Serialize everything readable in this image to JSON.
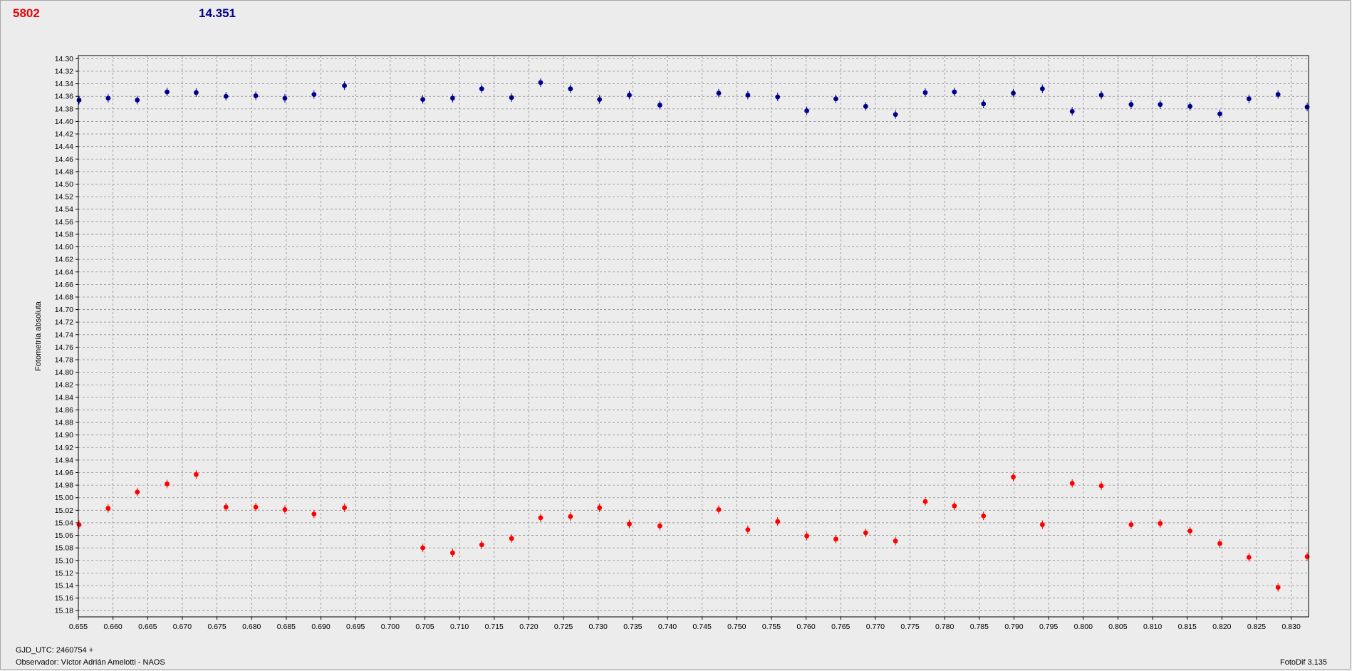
{
  "header": {
    "red_value": "5802",
    "blue_value": "14.351"
  },
  "footer": {
    "gjd": "GJD_UTC: 2460754 +",
    "observer": "Observador: Víctor Adrián Amelotti - NAOS",
    "version": "FotoDif 3.135"
  },
  "colors": {
    "background": "#ececec",
    "plot_bg": "#ececec",
    "grid": "#8a8a8a",
    "series_blue": "#00008b",
    "series_red": "#ff0000"
  },
  "chart_data": {
    "type": "scatter",
    "title": "",
    "xlabel": "",
    "ylabel": "Fotometría absoluta",
    "xlim": [
      0.655,
      0.8325
    ],
    "ylim": [
      14.295,
      15.19
    ],
    "y_inverted": true,
    "grid": true,
    "x_ticks": [
      "0.655",
      "0.660",
      "0.665",
      "0.670",
      "0.675",
      "0.680",
      "0.685",
      "0.690",
      "0.695",
      "0.700",
      "0.705",
      "0.710",
      "0.715",
      "0.720",
      "0.725",
      "0.730",
      "0.735",
      "0.740",
      "0.745",
      "0.750",
      "0.755",
      "0.760",
      "0.765",
      "0.770",
      "0.775",
      "0.780",
      "0.785",
      "0.790",
      "0.795",
      "0.800",
      "0.805",
      "0.810",
      "0.815",
      "0.820",
      "0.825",
      "0.830"
    ],
    "y_ticks": [
      "14.30",
      "14.32",
      "14.34",
      "14.36",
      "14.38",
      "14.40",
      "14.42",
      "14.44",
      "14.46",
      "14.48",
      "14.50",
      "14.52",
      "14.54",
      "14.56",
      "14.58",
      "14.60",
      "14.62",
      "14.64",
      "14.66",
      "14.68",
      "14.70",
      "14.72",
      "14.74",
      "14.76",
      "14.78",
      "14.80",
      "14.82",
      "14.84",
      "14.86",
      "14.88",
      "14.90",
      "14.92",
      "14.94",
      "14.96",
      "14.98",
      "15.00",
      "15.02",
      "15.04",
      "15.06",
      "15.08",
      "15.10",
      "15.12",
      "15.14",
      "15.16",
      "15.18"
    ],
    "series": [
      {
        "color": "#00008b",
        "x": [
          0.6551,
          0.6593,
          0.6635,
          0.6678,
          0.672,
          0.6763,
          0.6806,
          0.6848,
          0.689,
          0.6934,
          0.7047,
          0.709,
          0.7132,
          0.7175,
          0.7217,
          0.726,
          0.7302,
          0.7345,
          0.7389,
          0.7474,
          0.7516,
          0.7559,
          0.7601,
          0.7643,
          0.7686,
          0.7729,
          0.7772,
          0.7814,
          0.7856,
          0.7899,
          0.7941,
          0.7984,
          0.8026,
          0.8069,
          0.8111,
          0.8154,
          0.8197,
          0.8239,
          0.8281,
          0.8323
        ],
        "y": [
          14.366,
          14.363,
          14.366,
          14.353,
          14.354,
          14.36,
          14.359,
          14.363,
          14.357,
          14.343,
          14.365,
          14.363,
          14.348,
          14.362,
          14.338,
          14.348,
          14.365,
          14.358,
          14.374,
          14.355,
          14.358,
          14.361,
          14.383,
          14.364,
          14.376,
          14.389,
          14.354,
          14.353,
          14.372,
          14.355,
          14.348,
          14.384,
          14.358,
          14.373,
          14.373,
          14.376,
          14.388,
          14.364,
          14.357,
          14.377
        ]
      },
      {
        "color": "#ff0000",
        "x": [
          0.6551,
          0.6593,
          0.6635,
          0.6678,
          0.672,
          0.6763,
          0.6806,
          0.6848,
          0.689,
          0.6934,
          0.7047,
          0.709,
          0.7132,
          0.7175,
          0.7217,
          0.726,
          0.7302,
          0.7345,
          0.7389,
          0.7474,
          0.7516,
          0.7559,
          0.7601,
          0.7643,
          0.7686,
          0.7729,
          0.7772,
          0.7814,
          0.7856,
          0.7899,
          0.7941,
          0.7984,
          0.8026,
          0.8069,
          0.8111,
          0.8154,
          0.8197,
          0.8239,
          0.8281,
          0.8323
        ],
        "y": [
          15.043,
          15.017,
          14.991,
          14.978,
          14.963,
          15.015,
          15.015,
          15.019,
          15.026,
          15.016,
          15.08,
          15.088,
          15.075,
          15.065,
          15.032,
          15.03,
          15.016,
          15.042,
          15.045,
          15.019,
          15.051,
          15.038,
          15.061,
          15.066,
          15.056,
          15.069,
          15.006,
          15.013,
          15.029,
          14.967,
          15.043,
          14.977,
          14.981,
          15.043,
          15.041,
          15.053,
          15.073,
          15.095,
          15.143,
          15.094
        ]
      }
    ]
  }
}
